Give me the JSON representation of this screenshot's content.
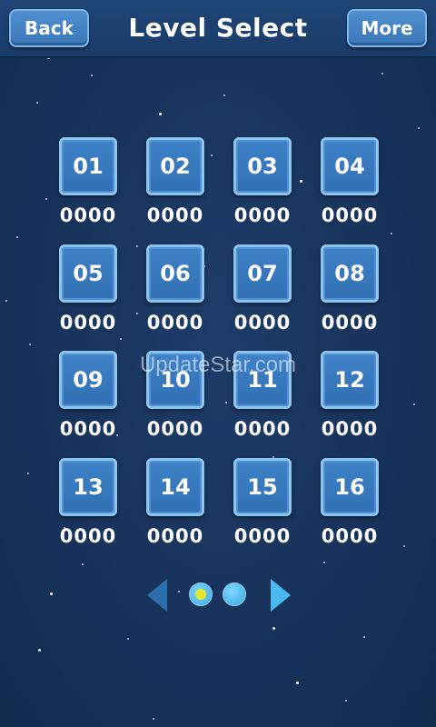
{
  "header": {
    "back_label": "Back",
    "title": "Level Select",
    "more_label": "More"
  },
  "levels": [
    {
      "number": "01",
      "score": "0000"
    },
    {
      "number": "02",
      "score": "0000"
    },
    {
      "number": "03",
      "score": "0000"
    },
    {
      "number": "04",
      "score": "0000"
    },
    {
      "number": "05",
      "score": "0000"
    },
    {
      "number": "06",
      "score": "0000"
    },
    {
      "number": "07",
      "score": "0000"
    },
    {
      "number": "08",
      "score": "0000"
    },
    {
      "number": "09",
      "score": "0000"
    },
    {
      "number": "10",
      "score": "0000"
    },
    {
      "number": "11",
      "score": "0000"
    },
    {
      "number": "12",
      "score": "0000"
    },
    {
      "number": "13",
      "score": "0000"
    },
    {
      "number": "14",
      "score": "0000"
    },
    {
      "number": "15",
      "score": "0000"
    },
    {
      "number": "16",
      "score": "0000"
    }
  ],
  "pager": {
    "page_count": 2,
    "current_page": 1
  },
  "watermark": "UpdateStar.com",
  "colors": {
    "background": "#18335a",
    "tile": "#3a7bc2",
    "tile_border": "#8cc4f0",
    "active_dot": "#e6e62a"
  }
}
